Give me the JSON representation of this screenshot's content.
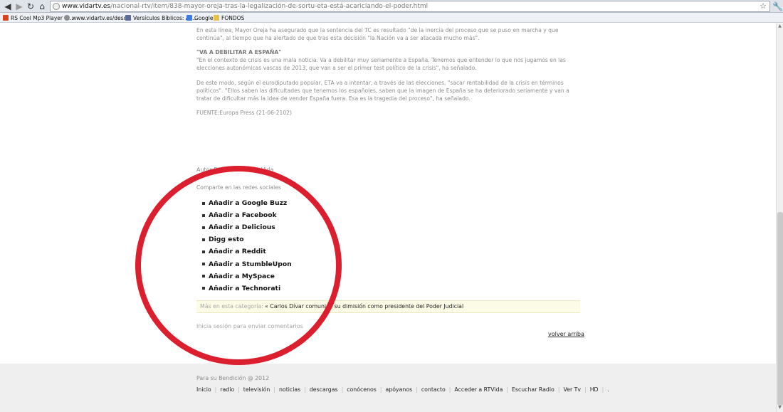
{
  "browser": {
    "url_domain": "www.vidartv.es",
    "url_path": "/nacional-rtv/item/838-mayor-oreja-tras-la-legalización-de-sortu-eta-está-acariciando-el-poder.html",
    "bookmarks": [
      {
        "label": "RS Cool Mp3 Player - ...",
        "color": "#d8451c"
      },
      {
        "label": "www.vidartv.es/desc...",
        "color": "#8e8e8e"
      },
      {
        "label": "Versículos Bíblicos: Al...",
        "color": "#5b6c9a"
      },
      {
        "label": "Google",
        "color": "#3d7be0"
      },
      {
        "label": "FONDOS",
        "color": "#e8c04a"
      }
    ]
  },
  "article": {
    "p1": "En esta línea, Mayor Oreja ha asegurado que la sentencia del TC es resultado \"de la inercia del proceso que se puso en marcha y que continúa\", al tiempo que ha alertado de que tras esta decisión \"la Nación va a ser atacada mucho más\".",
    "heading": "\"VA A DEBILITAR A ESPAÑA\"",
    "p2": "\"En el contexto de crisis es una mala noticia. Va a debilitar muy seriamente a España. Tenemos que entender lo que nos jugamos en las elecciones autonómicas vascas de 2013, que van a ser el primer test político de la crisis\", ha señalado.",
    "p3": "De este modo, según el eurodiputado popular, ETA va a intentar, a través de las elecciones, \"sacar rentabilidad de la crisis en términos políticos\". \"Ellos saben las dificultades que tenemos los españoles, saben que la imagen de España se ha deteriorado seriamente y van a tratar de dificultar más la idea de vender España fuera. Esa es la tragedia del proceso\", ha señalado.",
    "source": "FUENTE:Europa Press (21-06-2102)"
  },
  "author": "Autor  Radio Televisión Vida",
  "share": {
    "title": "Comparte en las redes sociales",
    "items": [
      "Añadir a Google Buzz",
      "Añadir a Facebook",
      "Añadir a Delicious",
      "Digg esto",
      "Añadir a Reddit",
      "Añadir a StumbleUpon",
      "Añadir a MySpace",
      "Añadir a Technorati"
    ]
  },
  "related": {
    "label": "Más en esta categoría:",
    "link": "« Carlos Dívar comunica su dimisión como presidente del Poder Judicial"
  },
  "login_note": "Inicia sesión para enviar comentarios",
  "back_to_top": "volver arriba",
  "footer": {
    "copyright": "Para su Bendición @ 2012",
    "nav": [
      "Inicio",
      "radio",
      "televisión",
      "noticias",
      "descargas",
      "conócenos",
      "apóyanos",
      "contacto",
      "Acceder a RTVida",
      "Escuchar Radio",
      "Ver Tv",
      "HD",
      "."
    ]
  },
  "colors": {
    "annotation_circle": "#dc1f2e",
    "related_background": "#fcfbe6"
  }
}
